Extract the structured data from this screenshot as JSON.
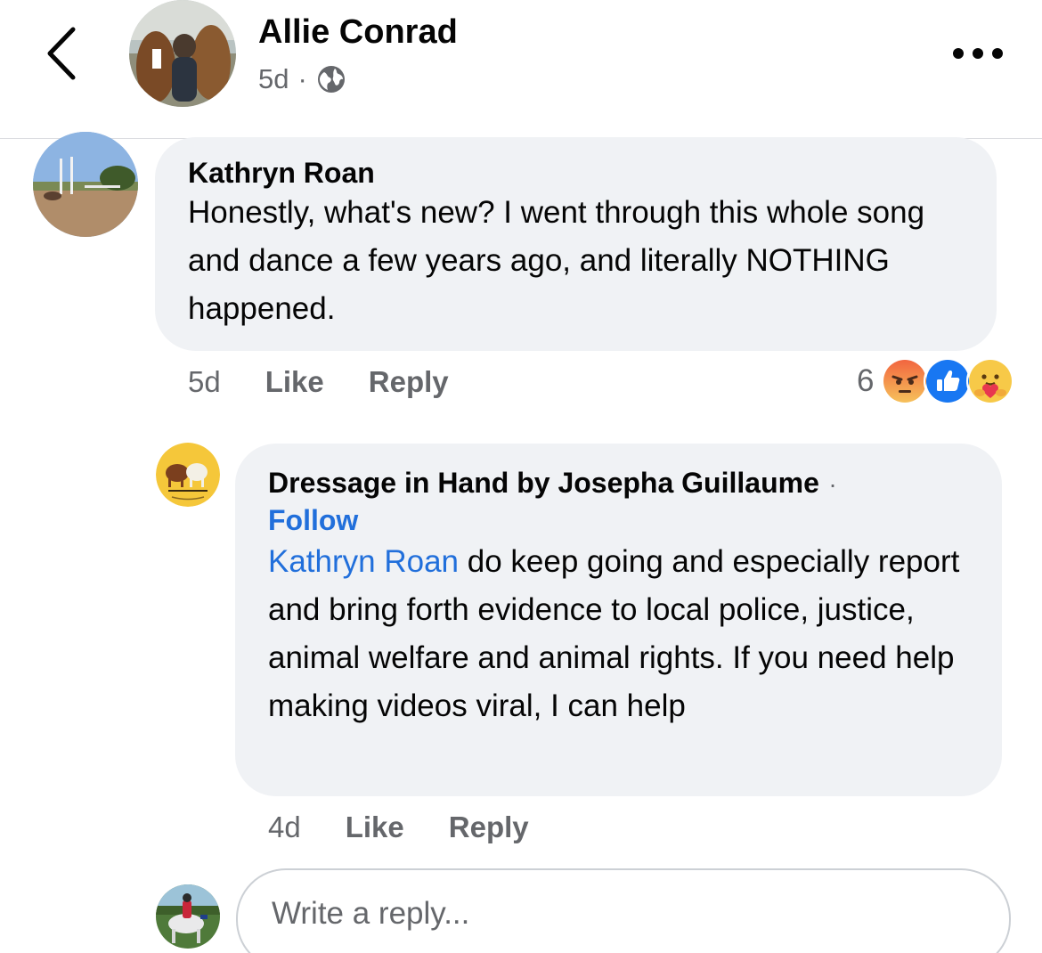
{
  "header": {
    "name": "Allie Conrad",
    "time": "5d",
    "separator": "·",
    "privacy_icon": "globe-icon",
    "back_icon": "chevron-left-icon",
    "more_icon": "more-horizontal-icon"
  },
  "comment1": {
    "author": "Kathryn Roan",
    "text": "Honestly, what's new? I went through this whole song and dance a few years ago, and literally NOTHING happened.",
    "time": "5d",
    "like_label": "Like",
    "reply_label": "Reply",
    "reaction_count": "6",
    "reactions": [
      "angry",
      "like",
      "care"
    ]
  },
  "comment2": {
    "author": "Dressage in Hand by Josepha Guillaume",
    "separator": "·",
    "follow_label": "Follow",
    "mention": "Kathryn Roan",
    "text": " do keep going and especially report and bring forth evidence to local police, justice, animal welfare and animal rights. If you need help making videos viral, I can help",
    "time": "4d",
    "like_label": "Like",
    "reply_label": "Reply",
    "avatar_logo_text": "Dressage in Hand"
  },
  "reply_box": {
    "placeholder": "Write a reply..."
  },
  "colors": {
    "link": "#216fdb",
    "bubble": "#f0f2f5",
    "secondary_text": "#65676b"
  }
}
